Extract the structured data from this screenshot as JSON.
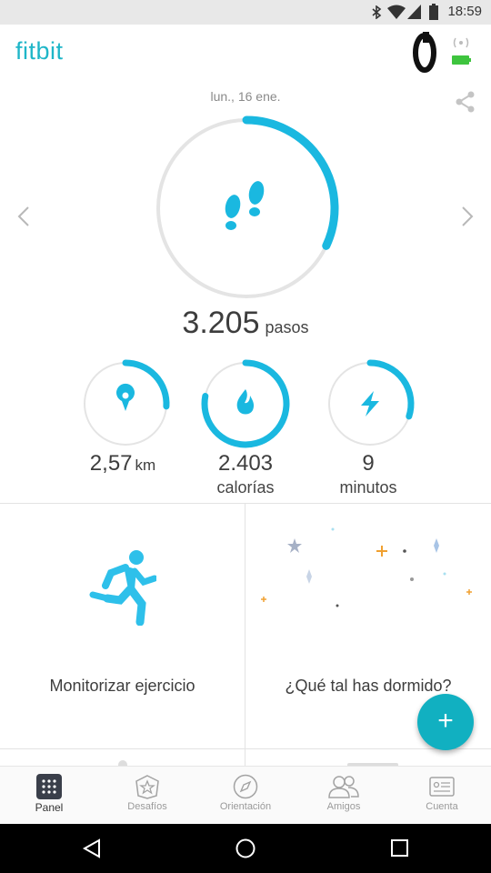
{
  "status_bar": {
    "time": "18:59"
  },
  "header": {
    "logo": "fitbit"
  },
  "dashboard": {
    "date": "lun., 16 ene.",
    "steps": {
      "value": "3.205",
      "unit": "pasos",
      "progress": 0.32
    },
    "distance": {
      "value": "2,57",
      "unit": "km",
      "progress": 0.26
    },
    "calories": {
      "value": "2.403",
      "unit": "calorías",
      "progress": 0.78
    },
    "active_minutes": {
      "value": "9",
      "unit": "minutos",
      "progress": 0.3
    }
  },
  "tiles": {
    "exercise": {
      "label": "Monitorizar ejercicio"
    },
    "sleep": {
      "label": "¿Qué tal has dormido?"
    }
  },
  "fab": {
    "label": "+"
  },
  "bottom_nav": [
    {
      "label": "Panel",
      "icon": "dashboard-grid-icon",
      "active": true
    },
    {
      "label": "Desafíos",
      "icon": "star-badge-icon",
      "active": false
    },
    {
      "label": "Orientación",
      "icon": "compass-icon",
      "active": false
    },
    {
      "label": "Amigos",
      "icon": "friends-icon",
      "active": false
    },
    {
      "label": "Cuenta",
      "icon": "account-card-icon",
      "active": false
    }
  ],
  "colors": {
    "brand": "#1fb6c8",
    "ring": "#1ab8e0",
    "ring_track": "#e4e4e4",
    "fab": "#11b0c1",
    "moon": "#1d3a78"
  }
}
